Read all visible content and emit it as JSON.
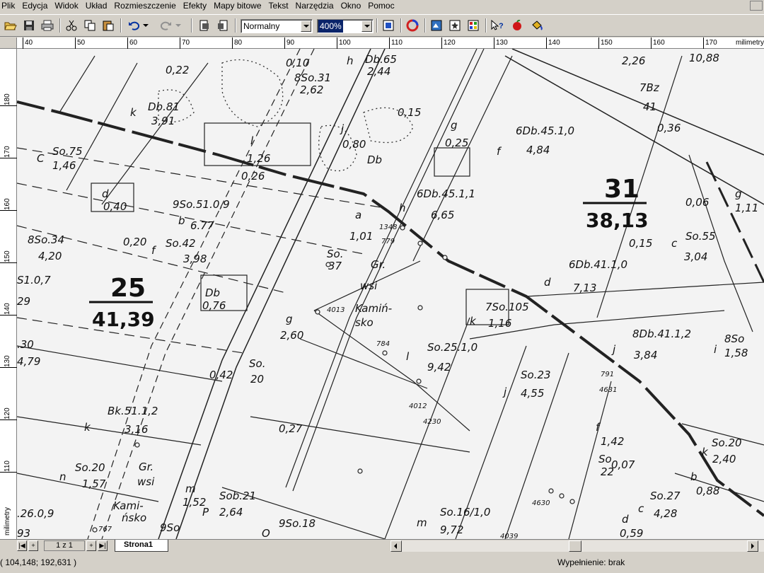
{
  "menu": [
    "Plik",
    "Edycja",
    "Widok",
    "Układ",
    "Rozmieszczenie",
    "Efekty",
    "Mapy bitowe",
    "Tekst",
    "Narzędzia",
    "Okno",
    "Pomoc"
  ],
  "toolbar": {
    "style_value": "Normalny",
    "zoom_value": "400%",
    "icons": [
      "open-icon",
      "save-icon",
      "print-icon",
      "cut-icon",
      "copy-icon",
      "paste-icon",
      "undo-icon",
      "redo-icon",
      "import-icon",
      "export-icon",
      "zoom-fit-icon",
      "color-wheel-icon",
      "toolbox-icon",
      "symbols-icon",
      "palette-icon",
      "help-icon",
      "apple-icon",
      "paint-bucket-icon"
    ]
  },
  "ruler": {
    "unit_top": "milimetry",
    "unit_left": "milimetry",
    "top_ticks": [
      "40",
      "50",
      "60",
      "70",
      "80",
      "90",
      "100",
      "110",
      "120",
      "130",
      "140",
      "150",
      "160",
      "170"
    ],
    "left_ticks": [
      "180",
      "170",
      "160",
      "150",
      "140",
      "130",
      "120",
      "110"
    ]
  },
  "map": {
    "parcel_big": [
      {
        "num": "25",
        "area": "41,39"
      },
      {
        "num": "31",
        "area": "38,13"
      }
    ],
    "labels": [
      "0,22",
      "k",
      "Db.81",
      "3,91",
      "C",
      "So.75",
      "1,46",
      "0,10",
      "8So.31",
      "2,62",
      "h",
      "Db.65",
      "2,44",
      "l",
      "1,26",
      "0,26",
      "j",
      "0,80",
      "Db",
      "0,15",
      "g",
      "0,25",
      "f",
      "6Db.45.1,0",
      "4,84",
      "d",
      "0,40",
      "b",
      "9So.51.0,9",
      "6.77",
      "h",
      "6Db.45.1,1",
      "6,65",
      "a",
      "1,01",
      "So.",
      "37",
      "8So.34",
      "4,20",
      "0,20",
      "f",
      "So.42",
      "3,98",
      "Gr.",
      "wsi",
      "Kamiń-",
      "sko",
      "4013",
      "784",
      "S1.0,7",
      "29",
      "Db",
      "0,76",
      "g",
      "2,60",
      "l",
      "So.25.1,0",
      "9,42",
      "k",
      "7So.105",
      "1,16",
      "d",
      "6Db.41.1,0",
      "7,13",
      "c",
      "So.55",
      "3,04",
      "0,15",
      "0,06",
      "g",
      "1,11",
      "7Bz",
      "41",
      "0,36",
      "2,26",
      "10,88",
      "j",
      "8Db.41.1,2",
      "3,84",
      "i",
      "8So",
      "1,58",
      ".30",
      "4,79",
      "0,42",
      "So.",
      "20",
      "j",
      "So.23",
      "4,55",
      "791",
      "4631",
      "k",
      "Bk.51.1,2",
      "3,16",
      "0,27",
      "4012",
      "4230",
      "f",
      "1,42",
      "So",
      "22",
      "0,07",
      "n",
      "So.20",
      "1,57",
      "Gr.",
      "wsi",
      "Kami-",
      "ńsko",
      "m",
      "1,52",
      "P",
      "Sob.21",
      "2,64",
      "k",
      "So.20",
      "2,40",
      "b",
      "0,88",
      "c",
      "So.27",
      "4,28",
      "d",
      "0,59",
      ".26.0,9",
      "93",
      "767",
      "9So",
      "O",
      "9So.18",
      "m",
      "So.16/1,0",
      "9,72",
      "4630",
      "4039",
      "1348",
      "779"
    ]
  },
  "pagebar": {
    "page_indicator": "1 z 1",
    "page_tab": "Strona1"
  },
  "status": {
    "coords": "( 104,148; 192,631 )",
    "fill": "Wypełnienie: brak"
  },
  "colors": {
    "chrome": "#d4d0c8",
    "selection": "#0a246a",
    "paper": "#f2f2f2",
    "ink": "#111111"
  }
}
